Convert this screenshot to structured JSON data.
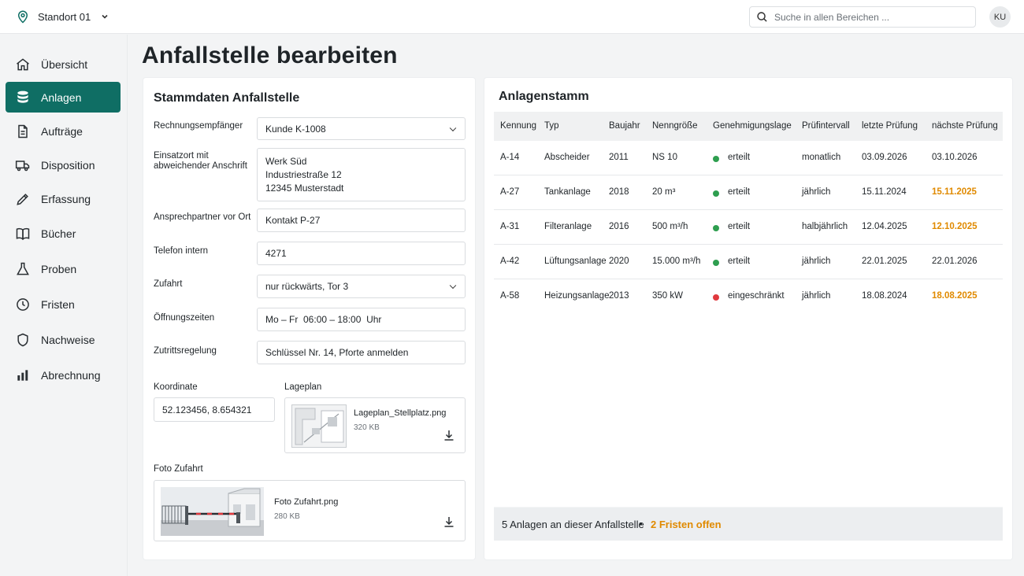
{
  "topbar": {
    "location": "Standort 01",
    "search_placeholder": "Suche in allen Bereichen ...",
    "avatar_initials": "KU"
  },
  "sidebar": {
    "items": [
      {
        "label": "Übersicht",
        "icon": "home-icon",
        "active": false
      },
      {
        "label": "Anlagen",
        "icon": "database-icon",
        "active": true
      },
      {
        "label": "Aufträge",
        "icon": "document-icon",
        "active": false
      },
      {
        "label": "Disposition",
        "icon": "truck-icon",
        "active": false
      },
      {
        "label": "Erfassung",
        "icon": "pencil-icon",
        "active": false
      },
      {
        "label": "Bücher",
        "icon": "book-icon",
        "active": false
      },
      {
        "label": "Proben",
        "icon": "flask-icon",
        "active": false
      },
      {
        "label": "Fristen",
        "icon": "clock-icon",
        "active": false
      },
      {
        "label": "Nachweise",
        "icon": "shield-icon",
        "active": false
      },
      {
        "label": "Abrechnung",
        "icon": "bar-chart-icon",
        "active": false
      }
    ]
  },
  "page_title": "Anfallstelle bearbeiten",
  "stammdaten": {
    "title": "Stammdaten Anfallstelle",
    "rechnungsempfaenger": {
      "label": "Rechnungsempfänger",
      "value": "Kunde K-1008"
    },
    "einsatzort": {
      "label_line1": "Einsatzort mit",
      "label_line2": "abweichender Anschrift",
      "lines": [
        "Werk Süd",
        "Industriestraße 12",
        "12345 Musterstadt"
      ]
    },
    "ansprechpartner": {
      "label": "Ansprechpartner vor Ort",
      "value": "Kontakt P-27"
    },
    "telefon": {
      "label": "Telefon intern",
      "value": "4271"
    },
    "zufahrt": {
      "label": "Zufahrt",
      "value": "nur rückwärts, Tor 3"
    },
    "oeffnungszeiten": {
      "label": "Öffnungszeiten",
      "value": "Mo – Fr  06:00 – 18:00  Uhr"
    },
    "zutritt": {
      "label": "Zutrittsregelung",
      "value": "Schlüssel Nr. 14, Pforte anmelden"
    },
    "koordinate": {
      "label": "Koordinate",
      "value": "52.123456, 8.654321"
    },
    "lageplan": {
      "label": "Lageplan",
      "file_name": "Lageplan_Stellplatz.png",
      "file_size": "320 KB"
    },
    "foto": {
      "label": "Foto Zufahrt",
      "file_name": "Foto Zufahrt.png",
      "file_size": "280 KB"
    }
  },
  "anlagenstamm": {
    "title": "Anlagenstamm",
    "columns": [
      "Kennung",
      "Typ",
      "Baujahr",
      "Nenngröße",
      "Genehmigungslage",
      "Prüfintervall",
      "letzte Prüfung",
      "nächste Prüfung"
    ],
    "rows": [
      {
        "kennung": "A-14",
        "typ": "Abscheider",
        "baujahr": "2011",
        "nenngroesse": "NS 10",
        "genehmigung": "erteilt",
        "status_color": "#2e9e4f",
        "intervall": "monatlich",
        "letzte": "03.09.2026",
        "naechste": "03.10.2026",
        "due": false
      },
      {
        "kennung": "A-27",
        "typ": "Tankanlage",
        "baujahr": "2018",
        "nenngroesse": "20 m³",
        "genehmigung": "erteilt",
        "status_color": "#2e9e4f",
        "intervall": "jährlich",
        "letzte": "15.11.2024",
        "naechste": "15.11.2025",
        "due": true
      },
      {
        "kennung": "A-31",
        "typ": "Filteranlage",
        "baujahr": "2016",
        "nenngroesse": "500 m³/h",
        "genehmigung": "erteilt",
        "status_color": "#2e9e4f",
        "intervall": "halbjährlich",
        "letzte": "12.04.2025",
        "naechste": "12.10.2025",
        "due": true
      },
      {
        "kennung": "A-42",
        "typ": "Lüftungsanlage",
        "baujahr": "2020",
        "nenngroesse": "15.000 m³/h",
        "genehmigung": "erteilt",
        "status_color": "#2e9e4f",
        "intervall": "jährlich",
        "letzte": "22.01.2025",
        "naechste": "22.01.2026",
        "due": false
      },
      {
        "kennung": "A-58",
        "typ": "Heizungsanlage",
        "baujahr": "2013",
        "nenngroesse": "350 kW",
        "genehmigung": "eingeschränkt",
        "status_color": "#e0393e",
        "intervall": "jährlich",
        "letzte": "18.08.2024",
        "naechste": "18.08.2025",
        "due": true
      }
    ],
    "footer_summary": "5 Anlagen an dieser Anfallstelle",
    "footer_separator": "•",
    "footer_open": "2 Fristen offen"
  },
  "colors": {
    "accent": "#0f6e64",
    "warning": "#e08a00",
    "ok": "#2e9e4f",
    "error": "#e0393e"
  }
}
